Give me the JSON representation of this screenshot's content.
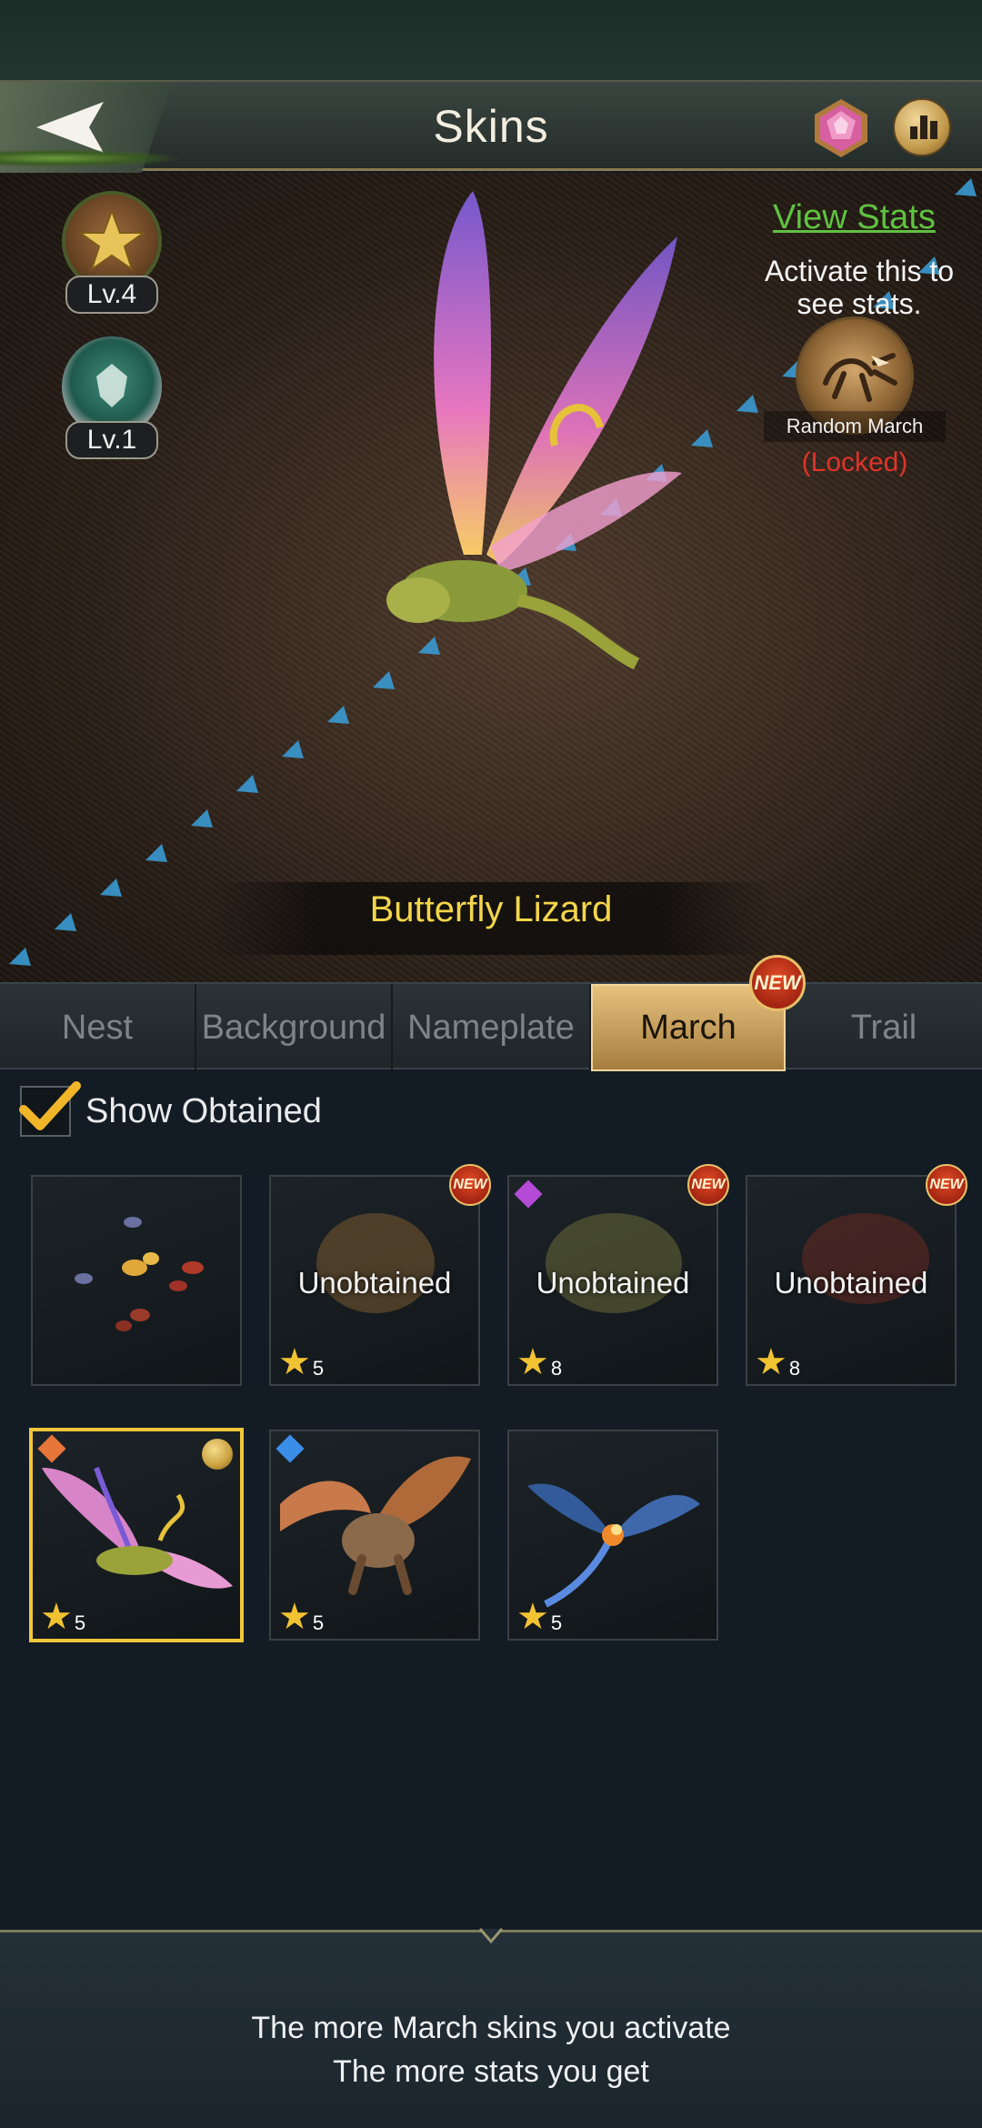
{
  "header": {
    "title": "Skins"
  },
  "preview": {
    "badges": [
      {
        "level": "Lv.4"
      },
      {
        "level": "Lv.1"
      }
    ],
    "view_stats": "View Stats",
    "activate_text": "Activate this to see stats.",
    "random_march_label": "Random March",
    "locked_label": "(Locked)",
    "skin_name": "Butterfly Lizard"
  },
  "tabs": [
    {
      "label": "Nest",
      "active": false
    },
    {
      "label": "Background",
      "active": false
    },
    {
      "label": "Nameplate",
      "active": false
    },
    {
      "label": "March",
      "active": true,
      "badge": "NEW"
    },
    {
      "label": "Trail",
      "active": false
    }
  ],
  "filter": {
    "show_obtained_label": "Show Obtained",
    "checked": true
  },
  "skins": [
    {
      "state": "obtained",
      "stars": "",
      "new": false,
      "icon": "ant-group-icon"
    },
    {
      "state": "Unobtained",
      "stars": "5",
      "new": true,
      "badge": "NEW",
      "icon": "tick-icon"
    },
    {
      "state": "Unobtained",
      "stars": "8",
      "new": true,
      "badge": "NEW",
      "icon": "bee-icon",
      "gem": "#b54ad6"
    },
    {
      "state": "Unobtained",
      "stars": "8",
      "new": true,
      "badge": "NEW",
      "icon": "beetle-icon"
    },
    {
      "state": "obtained",
      "stars": "5",
      "selected": true,
      "icon": "butterfly-lizard-icon",
      "gem": "#e8753a"
    },
    {
      "state": "obtained",
      "stars": "5",
      "icon": "dragon-icon",
      "gem": "#3a8ee8"
    },
    {
      "state": "obtained",
      "stars": "5",
      "icon": "dragonfly-icon"
    }
  ],
  "footer": {
    "line1": "The more March skins you activate",
    "line2": "The more stats you get"
  },
  "colors": {
    "accent_gold": "#f0c63a",
    "view_stats_green": "#5fc240",
    "locked_red": "#e0332a",
    "skin_name_yellow": "#f4d64a"
  }
}
